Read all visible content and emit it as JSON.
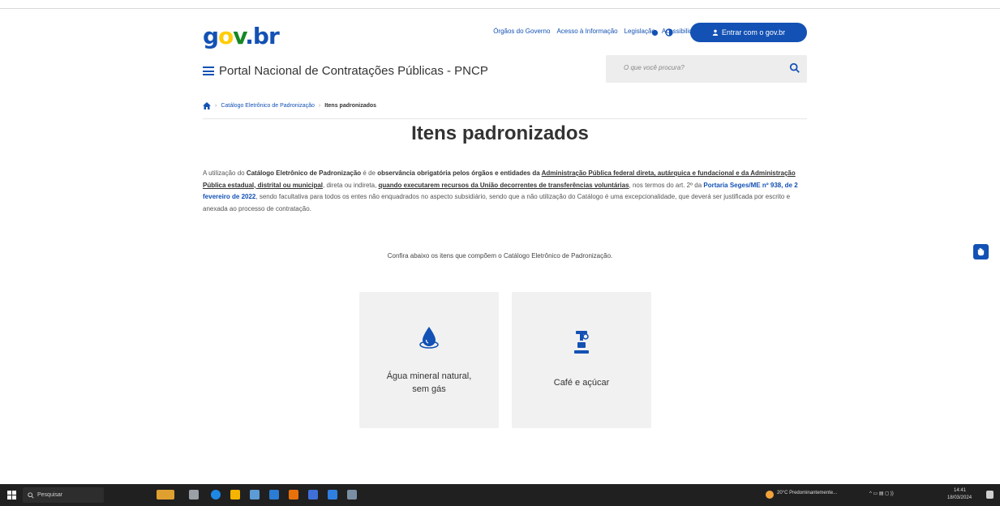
{
  "header": {
    "logo": {
      "g": "g",
      "o": "o",
      "v": "v",
      "b": ".br"
    },
    "links": [
      "Órgãos do Governo",
      "Acesso à Informação",
      "Legislação",
      "Acessibilidade"
    ],
    "login_label": "Entrar com o gov.br",
    "portal_title": "Portal Nacional de Contratações Públicas - PNCP",
    "search_placeholder": "O que você procura?"
  },
  "breadcrumb": {
    "items": [
      "Catálogo Eletrônico de Padronização",
      "Itens padronizados"
    ]
  },
  "page_title": "Itens padronizados",
  "intro": {
    "p1": "A utilização do ",
    "p2": "Catálogo Eletrônico de Padronização",
    "p3": " é de ",
    "p4": "observância obrigatória pelos órgãos e entidades da ",
    "p5": "Administração Pública federal direta, autárquica e fundacional",
    "p6": " e da Administração Pública estadual, distrital ou municipal",
    "p7": ", direta ou indireta, ",
    "p8": "quando executarem recursos da União decorrentes de transferências voluntárias",
    "p9": ", nos termos do art. 2º da ",
    "p10": "Portaria Seges/ME nº 938, de 2 fevereiro de 2022",
    "p11": ", sendo facultativa para todos os entes não enquadrados no aspecto subsidiário, sendo que a não utilização do Catálogo é uma excepcionalidade, que deverá ser justificada por escrito e anexada ao processo de contratação."
  },
  "subtitle": "Confira abaixo os itens que compõem o Catálogo Eletrônico de Padronização.",
  "cards": [
    {
      "label_line1": "Água mineral natural,",
      "label_line2": "sem gás",
      "icon": "water-drop-icon"
    },
    {
      "label_line1": "Café e açúcar",
      "label_line2": "",
      "icon": "coffee-machine-icon"
    }
  ],
  "taskbar": {
    "search_label": "Pesquisar",
    "weather": "20°C  Predominantemente...",
    "time": "14:41",
    "date": "18/03/2024"
  },
  "colors": {
    "primary": "#1351b4",
    "card_bg": "#f1f1f1",
    "taskbar_bg": "#202020"
  }
}
